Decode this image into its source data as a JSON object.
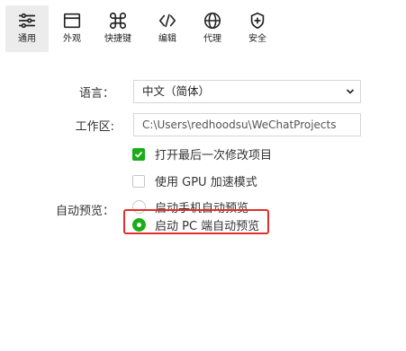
{
  "toolbar": {
    "items": [
      {
        "label": "通用",
        "icon": "sliders-icon",
        "active": true
      },
      {
        "label": "外观",
        "icon": "window-icon",
        "active": false
      },
      {
        "label": "快捷键",
        "icon": "command-key-icon",
        "active": false
      },
      {
        "label": "编辑",
        "icon": "code-icon",
        "active": false
      },
      {
        "label": "代理",
        "icon": "globe-icon",
        "active": false
      },
      {
        "label": "安全",
        "icon": "shield-icon",
        "active": false
      }
    ]
  },
  "settings": {
    "language_label": "语言：",
    "language_value": "中文（简体）",
    "workspace_label": "工作区:",
    "workspace_value": "C:\\Users\\redhoodsu\\WeChatProjects",
    "checkbox_open_recent": {
      "label": "打开最后一次修改项目",
      "checked": true
    },
    "checkbox_gpu": {
      "label": "使用 GPU 加速模式",
      "checked": false
    },
    "auto_preview_label": "自动预览：",
    "radio_mobile": {
      "label": "启动手机自动预览",
      "selected": false
    },
    "radio_pc": {
      "label": "启动 PC 端自动预览",
      "selected": true
    }
  },
  "colors": {
    "accent_green": "#1aad19",
    "highlight_red": "#e0302a"
  }
}
